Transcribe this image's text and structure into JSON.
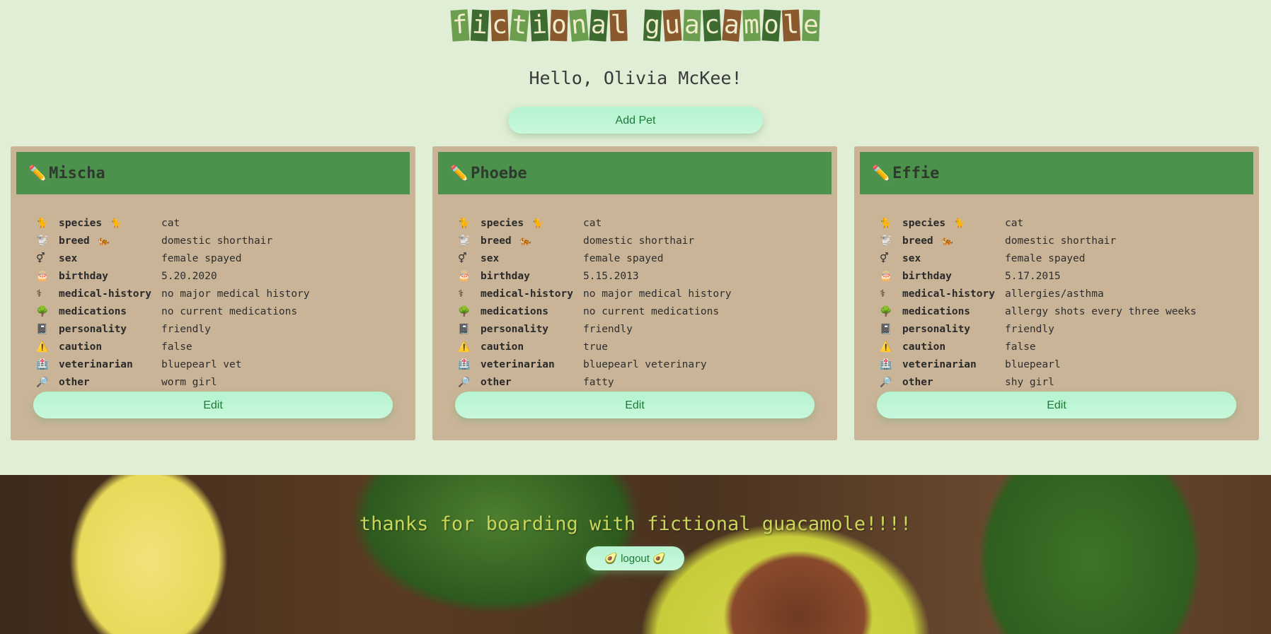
{
  "app": {
    "logo_letters": [
      "f",
      "i",
      "c",
      "t",
      "i",
      "o",
      "n",
      "a",
      "l",
      " ",
      "g",
      "u",
      "a",
      "c",
      "a",
      "m",
      "o",
      "l",
      "e"
    ],
    "greeting": "Hello, Olivia McKee!",
    "add_pet_label": "Add Pet",
    "colors": {
      "background": "#e0eed5",
      "card": "#c9b497",
      "card_header": "#4c914c",
      "button": "#b6f3d0",
      "logo_tiles": [
        "#6b9e4e",
        "#3e6b2f",
        "#8a5a2e"
      ]
    }
  },
  "pets": [
    {
      "name": "Mischa",
      "edit_label": "Edit",
      "rows": [
        {
          "icon": "🐈",
          "key": "species",
          "key_icon": "🐈",
          "value": "cat"
        },
        {
          "icon": "🐩",
          "key": "breed",
          "key_icon": "🐅",
          "value": "domestic shorthair"
        },
        {
          "icon": "⚥",
          "key": "sex",
          "key_icon": "",
          "value": "female spayed"
        },
        {
          "icon": "🎂",
          "key": "birthday",
          "key_icon": "",
          "value": "5.20.2020"
        },
        {
          "icon": "⚕",
          "key": "medical-history",
          "key_icon": "",
          "value": "no major medical history"
        },
        {
          "icon": "🌳",
          "key": "medications",
          "key_icon": "",
          "value": "no current medications"
        },
        {
          "icon": "📓",
          "key": "personality",
          "key_icon": "",
          "value": "friendly"
        },
        {
          "icon": "⚠️",
          "key": "caution",
          "key_icon": "",
          "value": "false"
        },
        {
          "icon": "🏥",
          "key": "veterinarian",
          "key_icon": "",
          "value": "bluepearl vet"
        },
        {
          "icon": "🔎",
          "key": "other",
          "key_icon": "",
          "value": "worm girl"
        }
      ]
    },
    {
      "name": "Phoebe",
      "edit_label": "Edit",
      "rows": [
        {
          "icon": "🐈",
          "key": "species",
          "key_icon": "🐈",
          "value": "cat"
        },
        {
          "icon": "🐩",
          "key": "breed",
          "key_icon": "🐅",
          "value": "domestic shorthair"
        },
        {
          "icon": "⚥",
          "key": "sex",
          "key_icon": "",
          "value": "female spayed"
        },
        {
          "icon": "🎂",
          "key": "birthday",
          "key_icon": "",
          "value": "5.15.2013"
        },
        {
          "icon": "⚕",
          "key": "medical-history",
          "key_icon": "",
          "value": "no major medical history"
        },
        {
          "icon": "🌳",
          "key": "medications",
          "key_icon": "",
          "value": "no current medications"
        },
        {
          "icon": "📓",
          "key": "personality",
          "key_icon": "",
          "value": "friendly"
        },
        {
          "icon": "⚠️",
          "key": "caution",
          "key_icon": "",
          "value": "true"
        },
        {
          "icon": "🏥",
          "key": "veterinarian",
          "key_icon": "",
          "value": "bluepearl veterinary"
        },
        {
          "icon": "🔎",
          "key": "other",
          "key_icon": "",
          "value": "fatty"
        }
      ]
    },
    {
      "name": "Effie",
      "edit_label": "Edit",
      "rows": [
        {
          "icon": "🐈",
          "key": "species",
          "key_icon": "🐈",
          "value": "cat"
        },
        {
          "icon": "🐩",
          "key": "breed",
          "key_icon": "🐅",
          "value": "domestic shorthair"
        },
        {
          "icon": "⚥",
          "key": "sex",
          "key_icon": "",
          "value": "female spayed"
        },
        {
          "icon": "🎂",
          "key": "birthday",
          "key_icon": "",
          "value": "5.17.2015"
        },
        {
          "icon": "⚕",
          "key": "medical-history",
          "key_icon": "",
          "value": "allergies/asthma"
        },
        {
          "icon": "🌳",
          "key": "medications",
          "key_icon": "",
          "value": "allergy shots every three weeks"
        },
        {
          "icon": "📓",
          "key": "personality",
          "key_icon": "",
          "value": "friendly"
        },
        {
          "icon": "⚠️",
          "key": "caution",
          "key_icon": "",
          "value": "false"
        },
        {
          "icon": "🏥",
          "key": "veterinarian",
          "key_icon": "",
          "value": "bluepearl"
        },
        {
          "icon": "🔎",
          "key": "other",
          "key_icon": "",
          "value": "shy girl"
        }
      ]
    }
  ],
  "footer": {
    "thanks": "thanks for boarding with fictional guacamole!!!!",
    "logout_label": "logout",
    "logout_icon": "🥑"
  }
}
